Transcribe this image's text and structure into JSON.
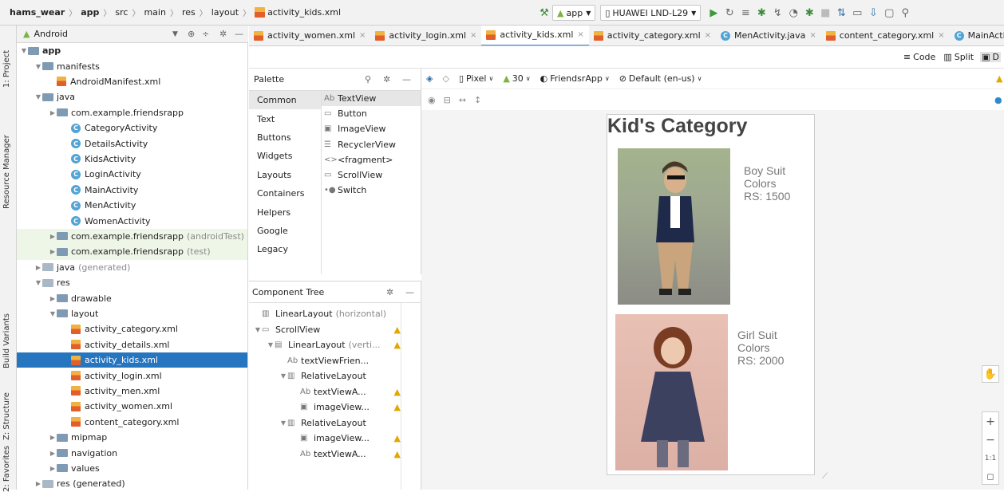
{
  "breadcrumb": {
    "items": [
      "hams_wear",
      "app",
      "src",
      "main",
      "res",
      "layout",
      "activity_kids.xml"
    ]
  },
  "toolbar": {
    "run_config": "app",
    "device": "HUAWEI LND-L29"
  },
  "side_tabs": {
    "project": "1: Project",
    "resource_manager": "Resource Manager",
    "build_variants": "Build Variants",
    "structure": "Z: Structure",
    "favorites": "2: Favorites"
  },
  "project_panel": {
    "view_mode": "Android",
    "tree": [
      {
        "label": "app",
        "level": 0,
        "kind": "module",
        "bold": true
      },
      {
        "label": "manifests",
        "level": 1,
        "kind": "folder"
      },
      {
        "label": "AndroidManifest.xml",
        "level": 2,
        "kind": "manifest"
      },
      {
        "label": "java",
        "level": 1,
        "kind": "folder"
      },
      {
        "label": "com.example.friendsrapp",
        "level": 2,
        "kind": "folder"
      },
      {
        "label": "CategoryActivity",
        "level": 3,
        "kind": "class"
      },
      {
        "label": "DetailsActivity",
        "level": 3,
        "kind": "class"
      },
      {
        "label": "KidsActivity",
        "level": 3,
        "kind": "class"
      },
      {
        "label": "LoginActivity",
        "level": 3,
        "kind": "class"
      },
      {
        "label": "MainActivity",
        "level": 3,
        "kind": "class"
      },
      {
        "label": "MenActivity",
        "level": 3,
        "kind": "class"
      },
      {
        "label": "WomenActivity",
        "level": 3,
        "kind": "class"
      },
      {
        "label": "com.example.friendsrapp",
        "suffix": "(androidTest)",
        "level": 2,
        "kind": "folder",
        "green": true
      },
      {
        "label": "com.example.friendsrapp",
        "suffix": "(test)",
        "level": 2,
        "kind": "folder",
        "green": true
      },
      {
        "label": "java",
        "suffix": "(generated)",
        "level": 1,
        "kind": "folder-gen"
      },
      {
        "label": "res",
        "level": 1,
        "kind": "folder-res"
      },
      {
        "label": "drawable",
        "level": 2,
        "kind": "folder"
      },
      {
        "label": "layout",
        "level": 2,
        "kind": "folder"
      },
      {
        "label": "activity_category.xml",
        "level": 3,
        "kind": "xml"
      },
      {
        "label": "activity_details.xml",
        "level": 3,
        "kind": "xml"
      },
      {
        "label": "activity_kids.xml",
        "level": 3,
        "kind": "xml",
        "selected": true
      },
      {
        "label": "activity_login.xml",
        "level": 3,
        "kind": "xml"
      },
      {
        "label": "activity_men.xml",
        "level": 3,
        "kind": "xml"
      },
      {
        "label": "activity_women.xml",
        "level": 3,
        "kind": "xml"
      },
      {
        "label": "content_category.xml",
        "level": 3,
        "kind": "xml"
      },
      {
        "label": "mipmap",
        "level": 2,
        "kind": "folder"
      },
      {
        "label": "navigation",
        "level": 2,
        "kind": "folder"
      },
      {
        "label": "values",
        "level": 2,
        "kind": "folder"
      },
      {
        "label": "res (generated)",
        "level": 1,
        "kind": "folder-res"
      }
    ]
  },
  "editor_tabs": [
    {
      "label": "activity_women.xml",
      "icon": "xml"
    },
    {
      "label": "activity_login.xml",
      "icon": "xml"
    },
    {
      "label": "activity_kids.xml",
      "icon": "xml",
      "active": true
    },
    {
      "label": "activity_category.xml",
      "icon": "xml"
    },
    {
      "label": "MenActivity.java",
      "icon": "class"
    },
    {
      "label": "content_category.xml",
      "icon": "xml"
    },
    {
      "label": "MainActivi",
      "icon": "class"
    }
  ],
  "view_modes": {
    "code": "Code",
    "split": "Split",
    "design": "D"
  },
  "palette": {
    "title": "Palette",
    "categories": [
      "Common",
      "Text",
      "Buttons",
      "Widgets",
      "Layouts",
      "Containers",
      "Helpers",
      "Google",
      "Legacy"
    ],
    "items": [
      {
        "label": "TextView",
        "icon": "Ab"
      },
      {
        "label": "Button",
        "icon": "▭"
      },
      {
        "label": "ImageView",
        "icon": "▣"
      },
      {
        "label": "RecyclerView",
        "icon": "☰"
      },
      {
        "label": "<fragment>",
        "icon": "<>"
      },
      {
        "label": "ScrollView",
        "icon": "▭"
      },
      {
        "label": "Switch",
        "icon": "•●"
      }
    ]
  },
  "component_tree": {
    "title": "Component Tree",
    "nodes": [
      {
        "label": "LinearLayout",
        "suffix": "(horizontal)",
        "level": 0,
        "icon": "▥",
        "warn": false
      },
      {
        "label": "ScrollView",
        "level": 0,
        "icon": "▭",
        "arrow": true,
        "warn": true
      },
      {
        "label": "LinearLayout",
        "suffix": "(verti...",
        "level": 1,
        "icon": "▤",
        "arrow": true,
        "warn": true
      },
      {
        "label": "textViewFrien...",
        "level": 2,
        "icon": "Ab",
        "warn": false
      },
      {
        "label": "RelativeLayout",
        "level": 2,
        "icon": "▥",
        "arrow": true,
        "warn": false
      },
      {
        "label": "textViewA...",
        "level": 3,
        "icon": "Ab",
        "warn": true
      },
      {
        "label": "imageView...",
        "level": 3,
        "icon": "▣",
        "warn": true
      },
      {
        "label": "RelativeLayout",
        "level": 2,
        "icon": "▥",
        "arrow": true,
        "warn": false
      },
      {
        "label": "imageView...",
        "level": 3,
        "icon": "▣",
        "warn": true
      },
      {
        "label": "textViewA...",
        "level": 3,
        "icon": "Ab",
        "warn": true
      }
    ]
  },
  "design_toolbar": {
    "device": "Pixel",
    "api": "30",
    "theme": "FriendsrApp",
    "locale": "Default (en-us)"
  },
  "preview": {
    "title": "Kid's Category",
    "products": [
      {
        "lines": [
          "Boy Suit",
          "Colors",
          "RS:  1500"
        ]
      },
      {
        "lines": [
          "Girl Suit",
          "Colors",
          "RS:  2000"
        ]
      }
    ]
  },
  "zoom_controls": {
    "fit": "1:1"
  }
}
